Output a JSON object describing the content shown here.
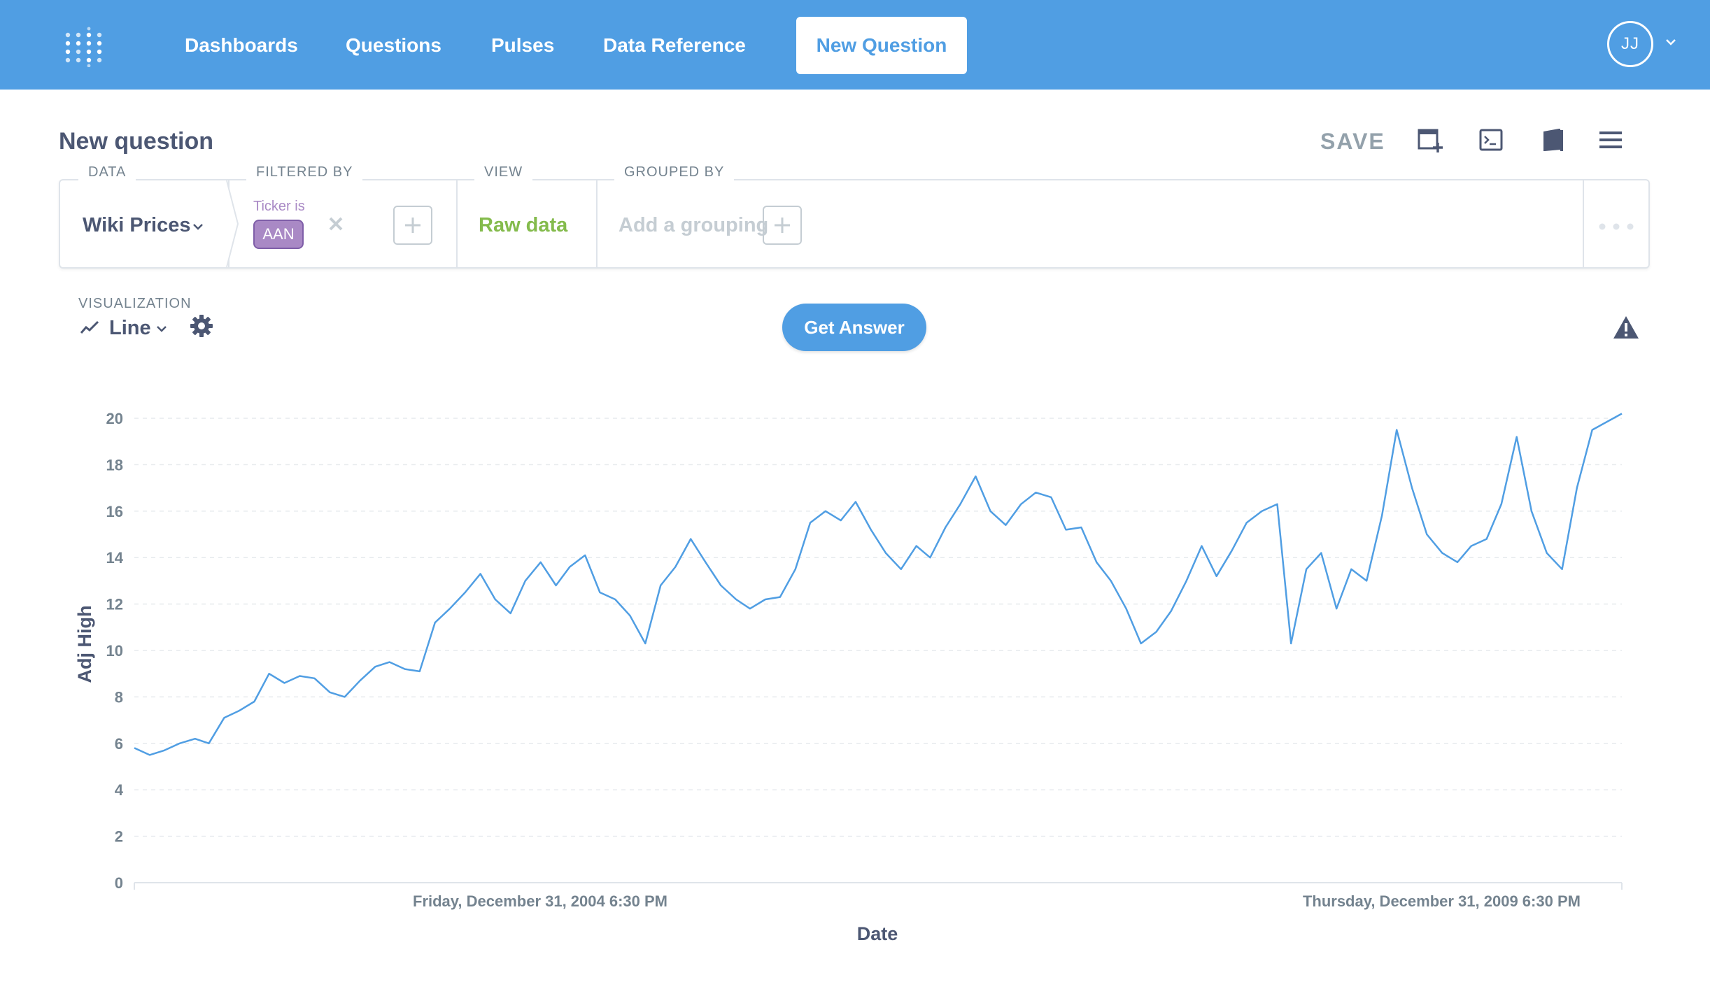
{
  "nav": {
    "links": [
      "Dashboards",
      "Questions",
      "Pulses",
      "Data Reference"
    ],
    "new_question": "New Question",
    "user_initials": "JJ",
    "brand_color": "#509ee3"
  },
  "header": {
    "title": "New question",
    "save_label": "SAVE",
    "icons": [
      "add-to-dashboard-icon",
      "sql-editor-icon",
      "data-reference-icon",
      "menu-icon"
    ]
  },
  "query": {
    "data_label": "DATA",
    "data_source": "Wiki Prices",
    "filter_label": "FILTERED BY",
    "filter_caption": "Ticker is",
    "filter_value": "AAN",
    "view_label": "VIEW",
    "view_value": "Raw data",
    "group_label": "GROUPED BY",
    "group_placeholder": "Add a grouping"
  },
  "visualization": {
    "label": "VISUALIZATION",
    "type": "Line",
    "button": "Get Answer"
  },
  "chart_data": {
    "type": "line",
    "xlabel": "Date",
    "ylabel": "Adj High",
    "ylim": [
      0,
      20
    ],
    "yticks": [
      0,
      2,
      4,
      6,
      8,
      10,
      12,
      14,
      16,
      18,
      20
    ],
    "xlim": [
      "2002-10-01",
      "2010-12-31"
    ],
    "xtick_labels": [
      {
        "date": "2004-12-31",
        "label": "Friday, December 31, 2004 6:30 PM"
      },
      {
        "date": "2009-12-31",
        "label": "Thursday, December 31, 2009 6:30 PM"
      }
    ],
    "grid": true,
    "line_color": "#509ee3",
    "series": [
      {
        "points": [
          [
            "2002-10-01",
            5.8
          ],
          [
            "2002-11-01",
            5.5
          ],
          [
            "2002-12-01",
            5.7
          ],
          [
            "2003-01-01",
            6.0
          ],
          [
            "2003-02-01",
            6.2
          ],
          [
            "2003-03-01",
            6.0
          ],
          [
            "2003-04-01",
            7.1
          ],
          [
            "2003-05-01",
            7.4
          ],
          [
            "2003-06-01",
            7.8
          ],
          [
            "2003-07-01",
            9.0
          ],
          [
            "2003-08-01",
            8.6
          ],
          [
            "2003-09-01",
            8.9
          ],
          [
            "2003-10-01",
            8.8
          ],
          [
            "2003-11-01",
            8.2
          ],
          [
            "2003-12-01",
            8.0
          ],
          [
            "2004-01-01",
            8.7
          ],
          [
            "2004-02-01",
            9.3
          ],
          [
            "2004-03-01",
            9.5
          ],
          [
            "2004-04-01",
            9.2
          ],
          [
            "2004-05-01",
            9.1
          ],
          [
            "2004-06-01",
            11.2
          ],
          [
            "2004-07-01",
            11.8
          ],
          [
            "2004-08-01",
            12.5
          ],
          [
            "2004-09-01",
            13.3
          ],
          [
            "2004-10-01",
            12.2
          ],
          [
            "2004-11-01",
            11.6
          ],
          [
            "2004-12-01",
            13.0
          ],
          [
            "2005-01-01",
            13.8
          ],
          [
            "2005-02-01",
            12.8
          ],
          [
            "2005-03-01",
            13.6
          ],
          [
            "2005-04-01",
            14.1
          ],
          [
            "2005-05-01",
            12.5
          ],
          [
            "2005-06-01",
            12.2
          ],
          [
            "2005-07-01",
            11.5
          ],
          [
            "2005-08-01",
            10.3
          ],
          [
            "2005-09-01",
            12.8
          ],
          [
            "2005-10-01",
            13.6
          ],
          [
            "2005-11-01",
            14.8
          ],
          [
            "2005-12-01",
            13.8
          ],
          [
            "2006-01-01",
            12.8
          ],
          [
            "2006-02-01",
            12.2
          ],
          [
            "2006-03-01",
            11.8
          ],
          [
            "2006-04-01",
            12.2
          ],
          [
            "2006-05-01",
            12.3
          ],
          [
            "2006-06-01",
            13.5
          ],
          [
            "2006-07-01",
            15.5
          ],
          [
            "2006-08-01",
            16.0
          ],
          [
            "2006-09-01",
            15.6
          ],
          [
            "2006-10-01",
            16.4
          ],
          [
            "2006-11-01",
            15.2
          ],
          [
            "2006-12-01",
            14.2
          ],
          [
            "2007-01-01",
            13.5
          ],
          [
            "2007-02-01",
            14.5
          ],
          [
            "2007-03-01",
            14.0
          ],
          [
            "2007-04-01",
            15.3
          ],
          [
            "2007-05-01",
            16.3
          ],
          [
            "2007-06-01",
            17.5
          ],
          [
            "2007-07-01",
            16.0
          ],
          [
            "2007-08-01",
            15.4
          ],
          [
            "2007-09-01",
            16.3
          ],
          [
            "2007-10-01",
            16.8
          ],
          [
            "2007-11-01",
            16.6
          ],
          [
            "2007-12-01",
            15.2
          ],
          [
            "2008-01-01",
            15.3
          ],
          [
            "2008-02-01",
            13.8
          ],
          [
            "2008-03-01",
            13.0
          ],
          [
            "2008-04-01",
            11.8
          ],
          [
            "2008-05-01",
            10.3
          ],
          [
            "2008-06-01",
            10.8
          ],
          [
            "2008-07-01",
            11.7
          ],
          [
            "2008-08-01",
            13.0
          ],
          [
            "2008-09-01",
            14.5
          ],
          [
            "2008-10-01",
            13.2
          ],
          [
            "2008-11-01",
            14.3
          ],
          [
            "2008-12-01",
            15.5
          ],
          [
            "2009-01-01",
            16.0
          ],
          [
            "2009-02-01",
            16.3
          ],
          [
            "2009-03-01",
            10.3
          ],
          [
            "2009-04-01",
            13.5
          ],
          [
            "2009-05-01",
            14.2
          ],
          [
            "2009-06-01",
            11.8
          ],
          [
            "2009-07-01",
            13.5
          ],
          [
            "2009-08-01",
            13.0
          ],
          [
            "2009-09-01",
            15.8
          ],
          [
            "2009-10-01",
            19.5
          ],
          [
            "2009-11-01",
            17.0
          ],
          [
            "2009-12-01",
            15.0
          ],
          [
            "2010-01-01",
            14.2
          ],
          [
            "2010-02-01",
            13.8
          ],
          [
            "2010-03-01",
            14.5
          ],
          [
            "2010-04-01",
            14.8
          ],
          [
            "2010-05-01",
            16.3
          ],
          [
            "2010-06-01",
            19.2
          ],
          [
            "2010-07-01",
            16.0
          ],
          [
            "2010-08-01",
            14.2
          ],
          [
            "2010-09-01",
            13.5
          ],
          [
            "2010-10-01",
            17.0
          ],
          [
            "2010-11-01",
            19.5
          ],
          [
            "2010-12-31",
            20.2
          ]
        ]
      }
    ]
  }
}
